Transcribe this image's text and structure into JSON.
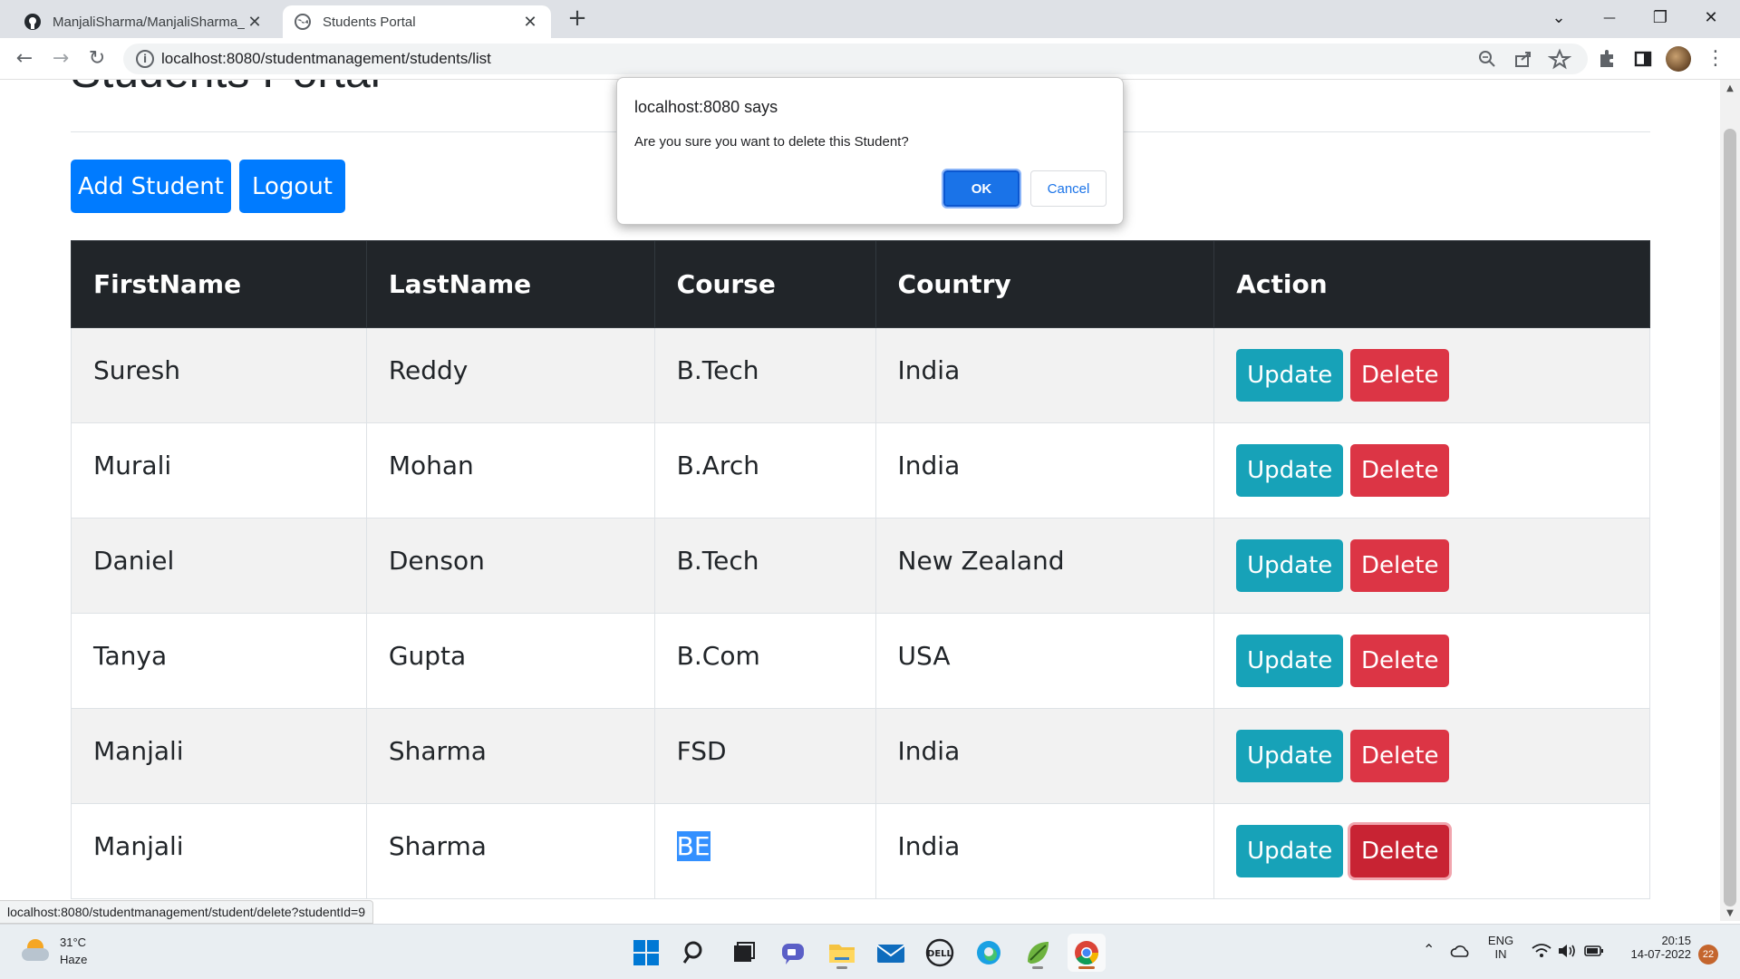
{
  "browser": {
    "tabs": [
      {
        "title": "ManjaliSharma/ManjaliSharma_L",
        "close": "✕"
      },
      {
        "title": "Students Portal",
        "close": "✕"
      }
    ],
    "new_tab": "+",
    "window_controls": {
      "dropdown": "⌄",
      "minimize": "—",
      "maximize": "❐",
      "close": "✕"
    },
    "nav": {
      "back": "←",
      "forward": "→",
      "reload": "↻"
    },
    "url": "localhost:8080/studentmanagement/students/list",
    "info_icon": "i",
    "status_url": "localhost:8080/studentmanagement/student/delete?studentId=9"
  },
  "page": {
    "title": "Students Portal",
    "add_button": "Add Student",
    "logout_button": "Logout",
    "table": {
      "headers": [
        "FirstName",
        "LastName",
        "Course",
        "Country",
        "Action"
      ],
      "rows": [
        {
          "first": "Suresh",
          "last": "Reddy",
          "course": "B.Tech",
          "country": "India"
        },
        {
          "first": "Murali",
          "last": "Mohan",
          "course": "B.Arch",
          "country": "India"
        },
        {
          "first": "Daniel",
          "last": "Denson",
          "course": "B.Tech",
          "country": "New Zealand"
        },
        {
          "first": "Tanya",
          "last": "Gupta",
          "course": "B.Com",
          "country": "USA"
        },
        {
          "first": "Manjali",
          "last": "Sharma",
          "course": "FSD",
          "country": "India"
        },
        {
          "first": "Manjali",
          "last": "Sharma",
          "course": "BE",
          "country": "India"
        }
      ],
      "update_label": "Update",
      "delete_label": "Delete"
    }
  },
  "dialog": {
    "header": "localhost:8080 says",
    "message": "Are you sure you want to delete this Student?",
    "ok": "OK",
    "cancel": "Cancel"
  },
  "taskbar": {
    "weather_temp": "31°C",
    "weather_desc": "Haze",
    "lang_top": "ENG",
    "lang_bottom": "IN",
    "time": "20:15",
    "date": "14-07-2022",
    "notifications": "22"
  },
  "colors": {
    "primary": "#007bff",
    "info": "#17a2b8",
    "danger": "#dc3545",
    "dark": "#212529"
  }
}
